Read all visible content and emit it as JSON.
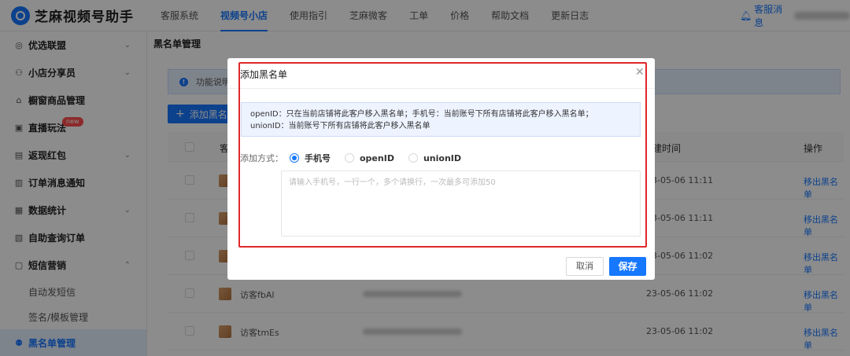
{
  "app": {
    "title": "芝麻视频号助手"
  },
  "nav": [
    "客服系统",
    "视频号小店",
    "使用指引",
    "芝麻微客",
    "工单",
    "价格",
    "帮助文档",
    "更新日志"
  ],
  "header_right": {
    "service_label": "客服消息"
  },
  "sidebar": {
    "items": [
      {
        "label": "优选联盟",
        "icon": "target-icon"
      },
      {
        "label": "小店分享员",
        "icon": "people-icon"
      },
      {
        "label": "橱窗商品管理",
        "icon": "storefront-icon"
      },
      {
        "label": "直播玩法",
        "icon": "play-icon",
        "badge": "new"
      },
      {
        "label": "返现红包",
        "icon": "redpacket-icon"
      },
      {
        "label": "订单消息通知",
        "icon": "notice-icon"
      },
      {
        "label": "数据统计",
        "icon": "chart-icon"
      },
      {
        "label": "自助查询订单",
        "icon": "doc-icon"
      },
      {
        "label": "短信营销",
        "icon": "sms-icon"
      }
    ],
    "sub_items": [
      "自动发短信",
      "签名/模板管理"
    ],
    "active": {
      "label": "黑名单管理",
      "icon": "blacklist-icon"
    }
  },
  "main": {
    "page_title": "黑名单管理",
    "notice_text": "功能说明",
    "add_button": "添加黑名单",
    "table": {
      "headers": [
        "客",
        "建时间",
        "操作"
      ],
      "rows": [
        {
          "nick": "",
          "time": "23-05-06 11:11",
          "op": "移出黑名单"
        },
        {
          "nick": "",
          "time": "23-05-06 11:11",
          "op": "移出黑名单"
        },
        {
          "nick": "",
          "time": "23-05-06 11:02",
          "op": "移出黑名单"
        },
        {
          "nick": "访客fbAl",
          "time": "23-05-06 11:02",
          "op": "移出黑名单"
        },
        {
          "nick": "访客tmEs",
          "time": "23-05-06 11:02",
          "op": "移出黑名单"
        }
      ]
    }
  },
  "modal": {
    "title": "添加黑名单",
    "info_line1": "openID：只在当前店铺将此客户移入黑名单；手机号：当前账号下所有店铺将此客户移入黑名单；",
    "info_line2": "unionID：当前账号下所有店铺将此客户移入黑名单",
    "method_label": "添加方式：",
    "options": [
      "手机号",
      "openID",
      "unionID"
    ],
    "selected_option": "手机号",
    "textarea_placeholder": "请输入手机号，一行一个，多个请换行，一次最多可添加50",
    "cancel_label": "取消",
    "save_label": "保存"
  },
  "colors": {
    "accent": "#1677ff",
    "highlight": "#e0282a",
    "badge": "#ff4d4f"
  }
}
